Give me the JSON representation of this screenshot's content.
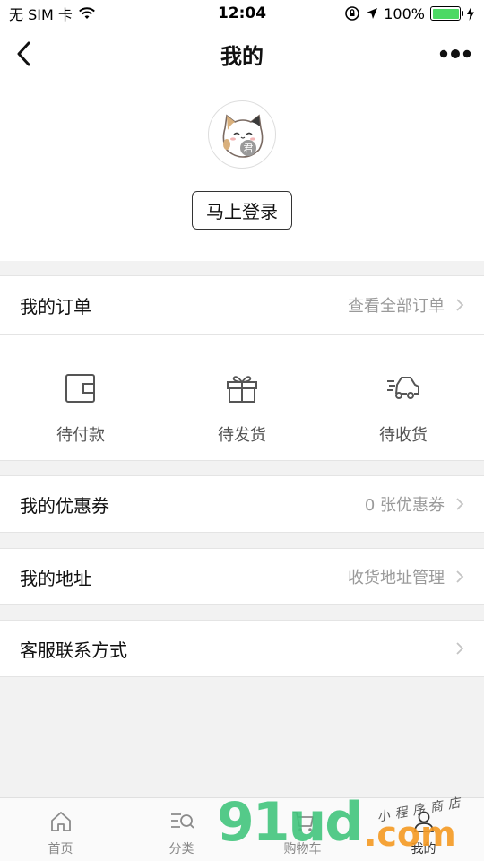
{
  "status_bar": {
    "carrier": "无 SIM 卡",
    "time": "12:04",
    "battery": "100%",
    "battery_level": 1.0,
    "battery_color": "#4cd964"
  },
  "nav": {
    "title": "我的",
    "back_icon": "chevron-left-icon",
    "more_icon": "more-dots-icon"
  },
  "profile": {
    "avatar_icon": "cat-avatar-icon",
    "avatar_badge": "君",
    "login_label": "马上登录"
  },
  "orders": {
    "title": "我的订单",
    "link": "查看全部订单",
    "statuses": [
      {
        "label": "待付款",
        "icon": "wallet-icon"
      },
      {
        "label": "待发货",
        "icon": "gift-icon"
      },
      {
        "label": "待收货",
        "icon": "delivery-truck-icon"
      }
    ]
  },
  "coupons": {
    "title": "我的优惠券",
    "value": "0 张优惠券"
  },
  "address": {
    "title": "我的地址",
    "value": "收货地址管理"
  },
  "service": {
    "title": "客服联系方式"
  },
  "tabs": [
    {
      "label": "首页",
      "icon": "home-icon"
    },
    {
      "label": "分类",
      "icon": "category-search-icon"
    },
    {
      "label": "购物车",
      "icon": "cart-icon"
    },
    {
      "label": "我的",
      "icon": "user-icon"
    }
  ],
  "watermark": {
    "brand": "91ud",
    "domain": ".com",
    "tagline": "小程序商店",
    "brand_color": "#3ec47a",
    "domain_color": "#f59a23"
  }
}
